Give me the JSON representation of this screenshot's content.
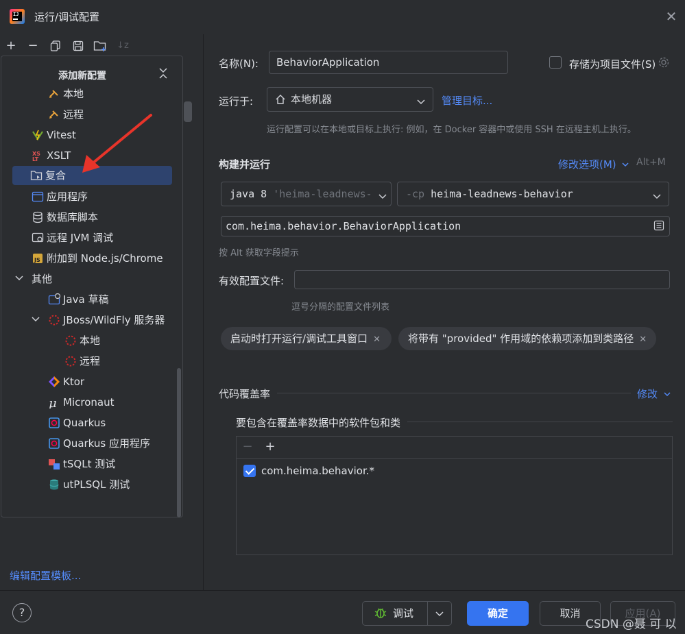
{
  "window": {
    "title": "运行/调试配置"
  },
  "popup": {
    "title": "添加新配置",
    "items": [
      {
        "label": "本地"
      },
      {
        "label": "远程"
      },
      {
        "label": "Vitest"
      },
      {
        "label": "XSLT"
      },
      {
        "label": "复合"
      },
      {
        "label": "应用程序"
      },
      {
        "label": "数据库脚本"
      },
      {
        "label": "远程 JVM 调试"
      },
      {
        "label": "附加到 Node.js/Chrome"
      },
      {
        "label": "其他"
      },
      {
        "label": "Java 草稿"
      },
      {
        "label": "JBoss/WildFly 服务器"
      },
      {
        "label": "本地"
      },
      {
        "label": "远程"
      },
      {
        "label": "Ktor"
      },
      {
        "label": "Micronaut"
      },
      {
        "label": "Quarkus"
      },
      {
        "label": "Quarkus 应用程序"
      },
      {
        "label": "tSQLt 测试"
      },
      {
        "label": "utPLSQL 测试"
      }
    ]
  },
  "left_footer": {
    "edit_templates": "编辑配置模板..."
  },
  "form": {
    "name_label": "名称(N):",
    "name_value": "BehaviorApplication",
    "store_label": "存储为项目文件(S)",
    "run_on_label": "运行于:",
    "run_on_value": "本地机器",
    "manage_targets": "管理目标...",
    "run_on_hint": "运行配置可以在本地或目标上执行: 例如，在 Docker 容器中或使用 SSH 在远程主机上执行。",
    "build_run_title": "构建并运行",
    "modify_options": "修改选项(M)",
    "modify_shortcut": "Alt+M",
    "jdk_prefix": "java 8",
    "jdk_detail": "'heima-leadnews-",
    "cp_prefix": "-cp",
    "cp_value": "heima-leadnews-behavior",
    "main_class": "com.heima.behavior.BehaviorApplication",
    "alt_hint": "按 Alt 获取字段提示",
    "profiles_label": "有效配置文件:",
    "profiles_value": "",
    "profiles_hint": "逗号分隔的配置文件列表",
    "chip1": "启动时打开运行/调试工具窗口",
    "chip2": "将带有 \"provided\" 作用域的依赖项添加到类路径",
    "coverage_title": "代码覆盖率",
    "coverage_modify": "修改",
    "coverage_include_title": "要包含在覆盖率数据中的软件包和类",
    "coverage_entry": "com.heima.behavior.*"
  },
  "buttons": {
    "debug": "调试",
    "ok": "确定",
    "cancel": "取消",
    "apply": "应用(A)"
  },
  "watermark": "CSDN @聂 可 以",
  "icons": {
    "add": "+",
    "remove": "−",
    "copy": "⧉",
    "save": "💾",
    "folder": "📁",
    "sort": "↓z",
    "help": "?",
    "close": "✕"
  }
}
